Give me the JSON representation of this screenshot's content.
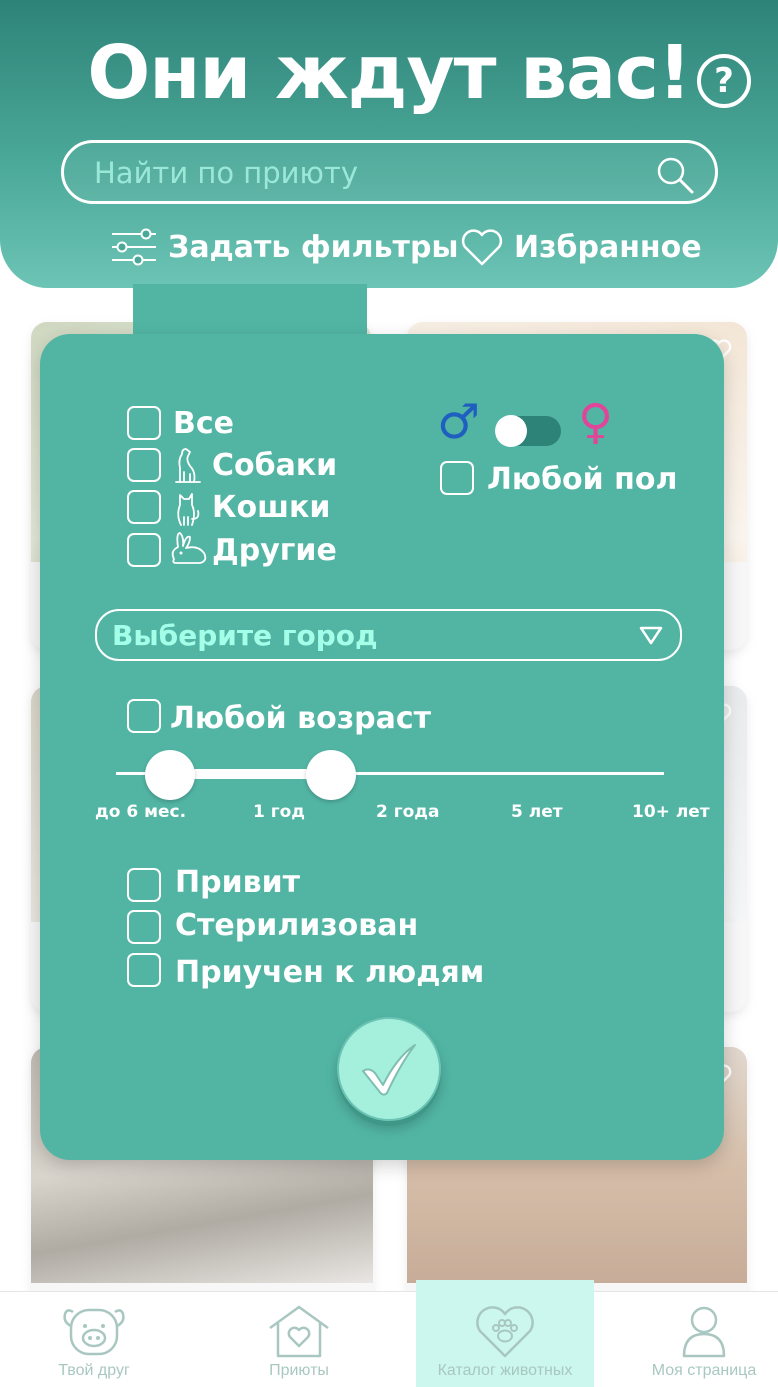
{
  "header": {
    "title": "Они ждут вас!",
    "help_icon_text": "?",
    "search": {
      "placeholder": "Найти по приюту"
    },
    "filters_label": "Задать фильтры",
    "favorites_label": "Избранное"
  },
  "filters": {
    "species": [
      {
        "label": "Все",
        "icon": "none"
      },
      {
        "label": "Собаки",
        "icon": "dog-icon"
      },
      {
        "label": "Кошки",
        "icon": "cat-icon"
      },
      {
        "label": "Другие",
        "icon": "rabbit-icon"
      }
    ],
    "gender": {
      "male_symbol": "♂",
      "female_symbol": "♀",
      "any_label": "Любой пол",
      "male_color": "#1f5fbf",
      "female_color": "#e0459a"
    },
    "city_placeholder": "Выберите город",
    "age": {
      "any_label": "Любой возраст",
      "ticks": [
        "до 6 мес.",
        "1 год",
        "2 года",
        "5 лет",
        "10+ лет"
      ],
      "selected_range": [
        "до 6 мес.",
        "1 год"
      ]
    },
    "attributes": [
      "Привит",
      "Стерилизован",
      "Приучен к людям"
    ],
    "confirm_icon": "checkmark-icon"
  },
  "nav": {
    "items": [
      {
        "label": "Твой друг",
        "icon": "pig-face-icon"
      },
      {
        "label": "Приюты",
        "icon": "house-heart-icon"
      },
      {
        "label": "Каталог животных",
        "icon": "paw-heart-icon"
      },
      {
        "label": "Моя страница",
        "icon": "user-icon"
      }
    ],
    "active": "Каталог животных"
  },
  "colors": {
    "header_dark": "#2e8378",
    "panel": "#52b5a4",
    "accent_light": "#a5f0dd",
    "nav_active": "#cbf7ee"
  }
}
